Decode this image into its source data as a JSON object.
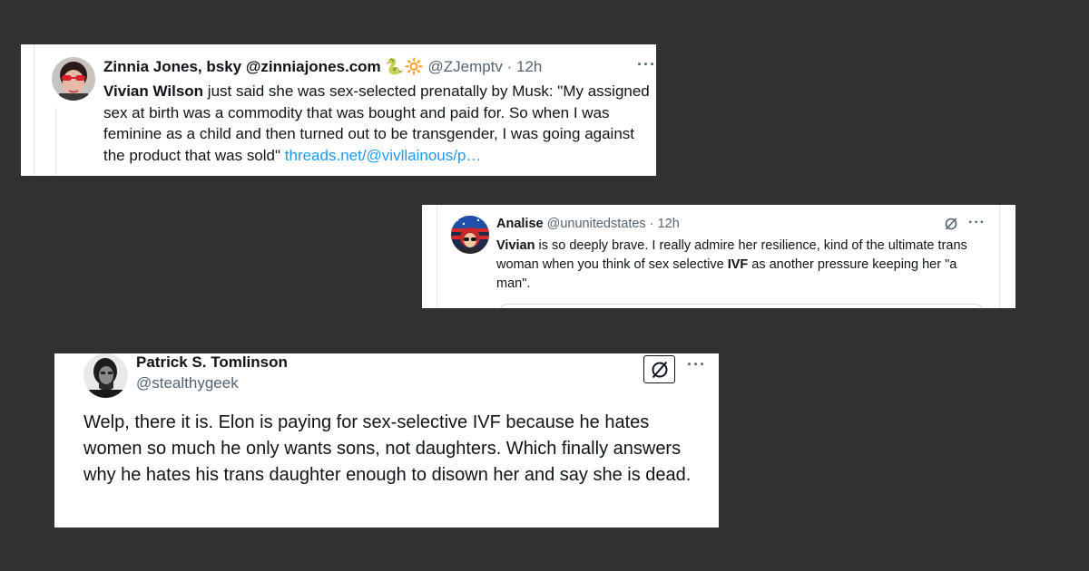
{
  "tweets": [
    {
      "display_name": "Zinnia Jones, bsky @zinniajones.com",
      "name_emoji": "🐍🔆",
      "handle": "@ZJemptv",
      "separator": " · ",
      "time": "12h",
      "mention": "Vivian Wilson",
      "text_1": " just said she was sex-selected prenatally by Musk: \"My assigned sex at birth was a commodity that was bought and paid for. So when I was feminine as a child and then turned out to be transgender, I was going against the product that was sold\" ",
      "link": "threads.net/@vivllainous/p…",
      "more_label": "···"
    },
    {
      "display_name": "Analise",
      "handle": "@ununitedstates",
      "separator": " · ",
      "time": "12h",
      "bold_1": "Vivian",
      "text_1": " is so deeply brave. I really admire her resilience, kind of the ultimate trans woman when you think of sex selective ",
      "bold_2": "IVF",
      "text_2": " as another pressure keeping her \"a man\".",
      "more_label": "···"
    },
    {
      "display_name": "Patrick S. Tomlinson",
      "handle": "@stealthygeek",
      "text": "Welp, there it is. Elon is paying for sex-selective IVF because he hates women so much he only wants sons, not daughters. Which finally answers why he hates his trans daughter enough to disown her and say she is dead.",
      "more_label": "···"
    }
  ],
  "colors": {
    "background": "#313131",
    "card": "#ffffff",
    "text": "#0f1419",
    "muted": "#536471",
    "link": "#1d9bf0"
  },
  "icons": [
    "avatar-zinnia",
    "avatar-analise",
    "avatar-patrick",
    "grok-icon",
    "more-icon"
  ]
}
